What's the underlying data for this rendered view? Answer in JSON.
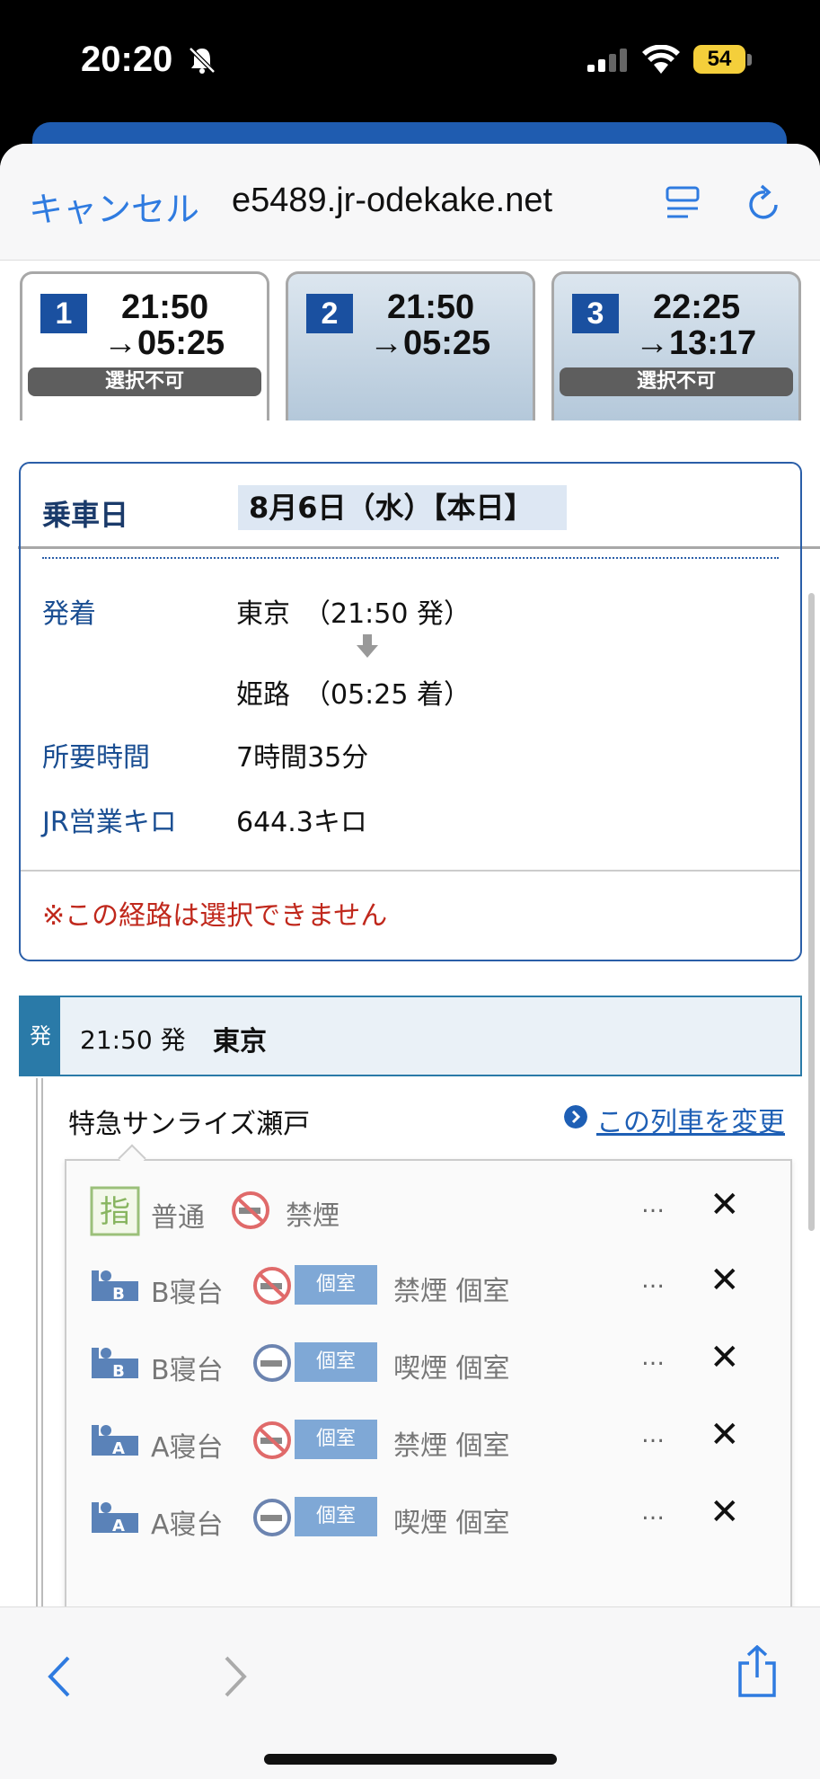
{
  "status": {
    "time": "20:20",
    "battery": "54"
  },
  "browser": {
    "cancel": "キャンセル",
    "domain": "e5489.jr-odekake.net"
  },
  "tabs": [
    {
      "num": "1",
      "dep": "21:50",
      "arr": "→05:25",
      "badge": "選択不可"
    },
    {
      "num": "2",
      "dep": "21:50",
      "arr": "→05:25",
      "badge": ""
    },
    {
      "num": "3",
      "dep": "22:25",
      "arr": "→13:17",
      "badge": "選択不可"
    }
  ],
  "info": {
    "date_label": "乗車日",
    "date_value": "8月6日（水）【本日】",
    "depart_label": "発着",
    "depart_value": "東京　（21:50 発）",
    "arrive_value": "姫路　（05:25 着）",
    "duration_label": "所要時間",
    "duration_value": "7時間35分",
    "distance_label": "JR営業キロ",
    "distance_value": "644.3キロ",
    "warning": "※この経路は選択できません"
  },
  "departure": {
    "tag": "発",
    "time": "21:50 発",
    "station": "東京"
  },
  "train": {
    "name": "特急サンライズ瀬戸",
    "change_link": "この列車を変更"
  },
  "seats": [
    {
      "icon": "reserved-seat-icon",
      "icon_text": "指",
      "type": "普通",
      "smoke": "no-smoking-icon",
      "room": "",
      "desc": "禁煙",
      "dots": "…",
      "status": "✕"
    },
    {
      "icon": "sleeper-b-icon",
      "icon_text": "B",
      "type": "B寝台",
      "smoke": "no-smoking-icon",
      "room": "個室",
      "desc": "禁煙 個室",
      "dots": "…",
      "status": "✕"
    },
    {
      "icon": "sleeper-b-icon",
      "icon_text": "B",
      "type": "B寝台",
      "smoke": "smoking-icon",
      "room": "個室",
      "desc": "喫煙 個室",
      "dots": "…",
      "status": "✕"
    },
    {
      "icon": "sleeper-a-icon",
      "icon_text": "A",
      "type": "A寝台",
      "smoke": "no-smoking-icon",
      "room": "個室",
      "desc": "禁煙 個室",
      "dots": "…",
      "status": "✕"
    },
    {
      "icon": "sleeper-a-icon",
      "icon_text": "A",
      "type": "A寝台",
      "smoke": "smoking-icon",
      "room": "個室",
      "desc": "喫煙 個室",
      "dots": "…",
      "status": "✕"
    }
  ],
  "colors": {
    "accent": "#2f7be0",
    "brand": "#1a50a0",
    "warning": "#c0281c"
  }
}
